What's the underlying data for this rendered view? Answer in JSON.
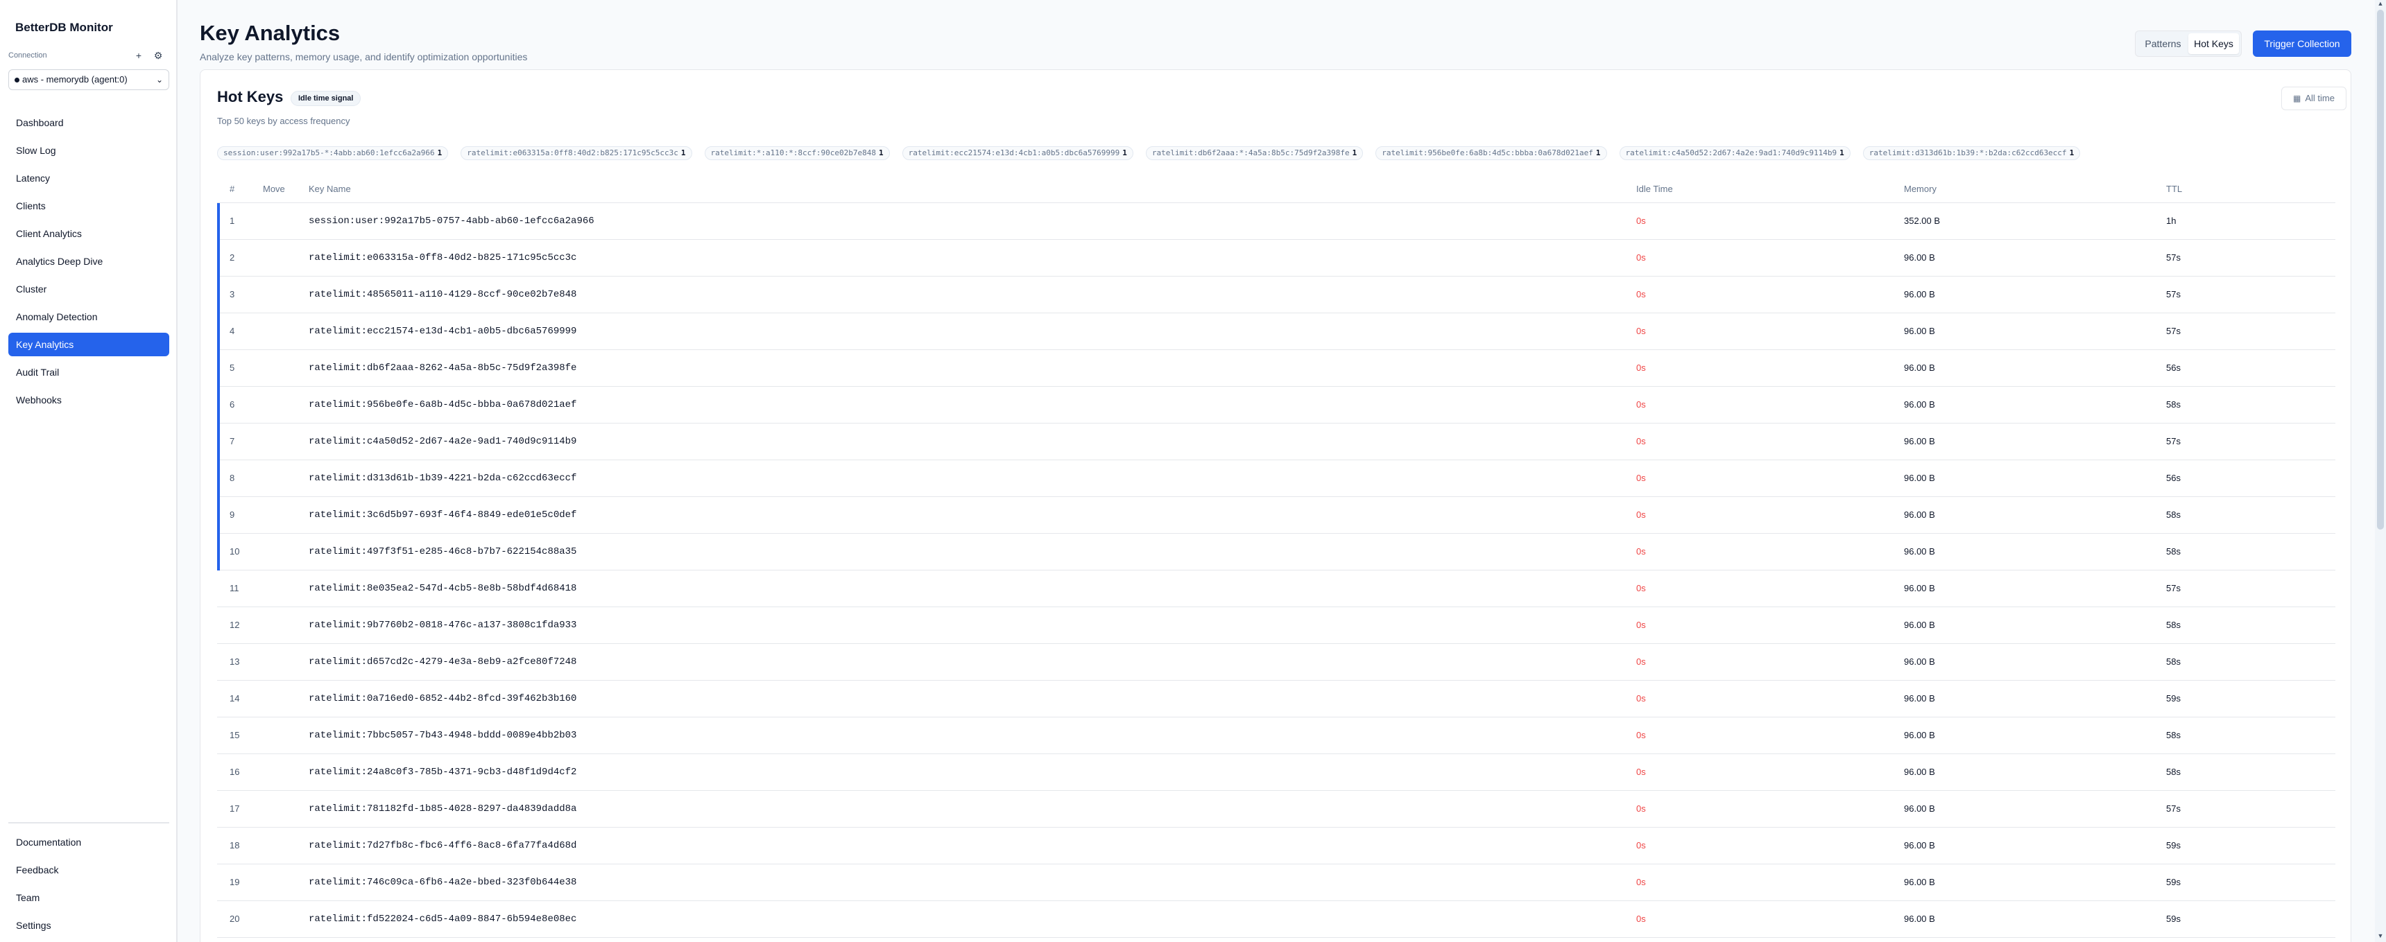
{
  "sidebar": {
    "brand": "BetterDB Monitor",
    "connection_label": "Connection",
    "connection_value": "aws - memorydb (agent:0)",
    "nav": [
      {
        "label": "Dashboard",
        "active": false
      },
      {
        "label": "Slow Log",
        "active": false
      },
      {
        "label": "Latency",
        "active": false
      },
      {
        "label": "Clients",
        "active": false
      },
      {
        "label": "Client Analytics",
        "active": false
      },
      {
        "label": "Analytics Deep Dive",
        "active": false
      },
      {
        "label": "Cluster",
        "active": false
      },
      {
        "label": "Anomaly Detection",
        "active": false
      },
      {
        "label": "Key Analytics",
        "active": true
      },
      {
        "label": "Audit Trail",
        "active": false
      },
      {
        "label": "Webhooks",
        "active": false
      }
    ],
    "bottom_nav": [
      {
        "label": "Documentation"
      },
      {
        "label": "Feedback"
      },
      {
        "label": "Team"
      },
      {
        "label": "Settings"
      }
    ]
  },
  "header": {
    "title": "Key Analytics",
    "subtitle": "Analyze key patterns, memory usage, and identify optimization opportunities",
    "toggle": [
      "Patterns",
      "Hot Keys"
    ],
    "active_toggle": "Hot Keys",
    "trigger_label": "Trigger Collection"
  },
  "card": {
    "title": "Hot Keys",
    "badge": "Idle time signal",
    "subtitle": "Top 50 keys by access frequency",
    "range_label": "All time",
    "chips": [
      {
        "text": "session:user:992a17b5-*:4abb:ab60:1efcc6a2a966",
        "count": "1"
      },
      {
        "text": "ratelimit:e063315a:0ff8:40d2:b825:171c95c5cc3c",
        "count": "1"
      },
      {
        "text": "ratelimit:*:a110:*:8ccf:90ce02b7e848",
        "count": "1"
      },
      {
        "text": "ratelimit:ecc21574:e13d:4cb1:a0b5:dbc6a5769999",
        "count": "1"
      },
      {
        "text": "ratelimit:db6f2aaa:*:4a5a:8b5c:75d9f2a398fe",
        "count": "1"
      },
      {
        "text": "ratelimit:956be0fe:6a8b:4d5c:bbba:0a678d021aef",
        "count": "1"
      },
      {
        "text": "ratelimit:c4a50d52:2d67:4a2e:9ad1:740d9c9114b9",
        "count": "1"
      },
      {
        "text": "ratelimit:d313d61b:1b39:*:b2da:c62ccd63eccf",
        "count": "1"
      }
    ],
    "columns": {
      "rank": "#",
      "move": "Move",
      "key": "Key Name",
      "idle": "Idle Time",
      "memory": "Memory",
      "ttl": "TTL"
    },
    "rows": [
      {
        "rank": "1",
        "key": "session:user:992a17b5-0757-4abb-ab60-1efcc6a2a966",
        "idle": "0s",
        "memory": "352.00 B",
        "ttl": "1h",
        "hot": true
      },
      {
        "rank": "2",
        "key": "ratelimit:e063315a-0ff8-40d2-b825-171c95c5cc3c",
        "idle": "0s",
        "memory": "96.00 B",
        "ttl": "57s",
        "hot": true
      },
      {
        "rank": "3",
        "key": "ratelimit:48565011-a110-4129-8ccf-90ce02b7e848",
        "idle": "0s",
        "memory": "96.00 B",
        "ttl": "57s",
        "hot": true
      },
      {
        "rank": "4",
        "key": "ratelimit:ecc21574-e13d-4cb1-a0b5-dbc6a5769999",
        "idle": "0s",
        "memory": "96.00 B",
        "ttl": "57s",
        "hot": true
      },
      {
        "rank": "5",
        "key": "ratelimit:db6f2aaa-8262-4a5a-8b5c-75d9f2a398fe",
        "idle": "0s",
        "memory": "96.00 B",
        "ttl": "56s",
        "hot": true
      },
      {
        "rank": "6",
        "key": "ratelimit:956be0fe-6a8b-4d5c-bbba-0a678d021aef",
        "idle": "0s",
        "memory": "96.00 B",
        "ttl": "58s",
        "hot": true
      },
      {
        "rank": "7",
        "key": "ratelimit:c4a50d52-2d67-4a2e-9ad1-740d9c9114b9",
        "idle": "0s",
        "memory": "96.00 B",
        "ttl": "57s",
        "hot": true
      },
      {
        "rank": "8",
        "key": "ratelimit:d313d61b-1b39-4221-b2da-c62ccd63eccf",
        "idle": "0s",
        "memory": "96.00 B",
        "ttl": "56s",
        "hot": true
      },
      {
        "rank": "9",
        "key": "ratelimit:3c6d5b97-693f-46f4-8849-ede01e5c0def",
        "idle": "0s",
        "memory": "96.00 B",
        "ttl": "58s",
        "hot": true
      },
      {
        "rank": "10",
        "key": "ratelimit:497f3f51-e285-46c8-b7b7-622154c88a35",
        "idle": "0s",
        "memory": "96.00 B",
        "ttl": "58s",
        "hot": true
      },
      {
        "rank": "11",
        "key": "ratelimit:8e035ea2-547d-4cb5-8e8b-58bdf4d68418",
        "idle": "0s",
        "memory": "96.00 B",
        "ttl": "57s",
        "hot": false
      },
      {
        "rank": "12",
        "key": "ratelimit:9b7760b2-0818-476c-a137-3808c1fda933",
        "idle": "0s",
        "memory": "96.00 B",
        "ttl": "58s",
        "hot": false
      },
      {
        "rank": "13",
        "key": "ratelimit:d657cd2c-4279-4e3a-8eb9-a2fce80f7248",
        "idle": "0s",
        "memory": "96.00 B",
        "ttl": "58s",
        "hot": false
      },
      {
        "rank": "14",
        "key": "ratelimit:0a716ed0-6852-44b2-8fcd-39f462b3b160",
        "idle": "0s",
        "memory": "96.00 B",
        "ttl": "59s",
        "hot": false
      },
      {
        "rank": "15",
        "key": "ratelimit:7bbc5057-7b43-4948-bddd-0089e4bb2b03",
        "idle": "0s",
        "memory": "96.00 B",
        "ttl": "58s",
        "hot": false
      },
      {
        "rank": "16",
        "key": "ratelimit:24a8c0f3-785b-4371-9cb3-d48f1d9d4cf2",
        "idle": "0s",
        "memory": "96.00 B",
        "ttl": "58s",
        "hot": false
      },
      {
        "rank": "17",
        "key": "ratelimit:781182fd-1b85-4028-8297-da4839dadd8a",
        "idle": "0s",
        "memory": "96.00 B",
        "ttl": "57s",
        "hot": false
      },
      {
        "rank": "18",
        "key": "ratelimit:7d27fb8c-fbc6-4ff6-8ac8-6fa77fa4d68d",
        "idle": "0s",
        "memory": "96.00 B",
        "ttl": "59s",
        "hot": false
      },
      {
        "rank": "19",
        "key": "ratelimit:746c09ca-6fb6-4a2e-bbed-323f0b644e38",
        "idle": "0s",
        "memory": "96.00 B",
        "ttl": "59s",
        "hot": false
      },
      {
        "rank": "20",
        "key": "ratelimit:fd522024-c6d5-4a09-8847-6b594e8e08ec",
        "idle": "0s",
        "memory": "96.00 B",
        "ttl": "59s",
        "hot": false
      }
    ]
  },
  "colors": {
    "accent": "#2563eb",
    "idle_time": "#ef4444",
    "border": "#e5e7eb",
    "muted_text": "#64748b"
  },
  "icons": {
    "add_connection": "plus-icon",
    "connection_settings": "gear-icon",
    "range": "calendar-icon",
    "select": "chevron-down-icon"
  }
}
